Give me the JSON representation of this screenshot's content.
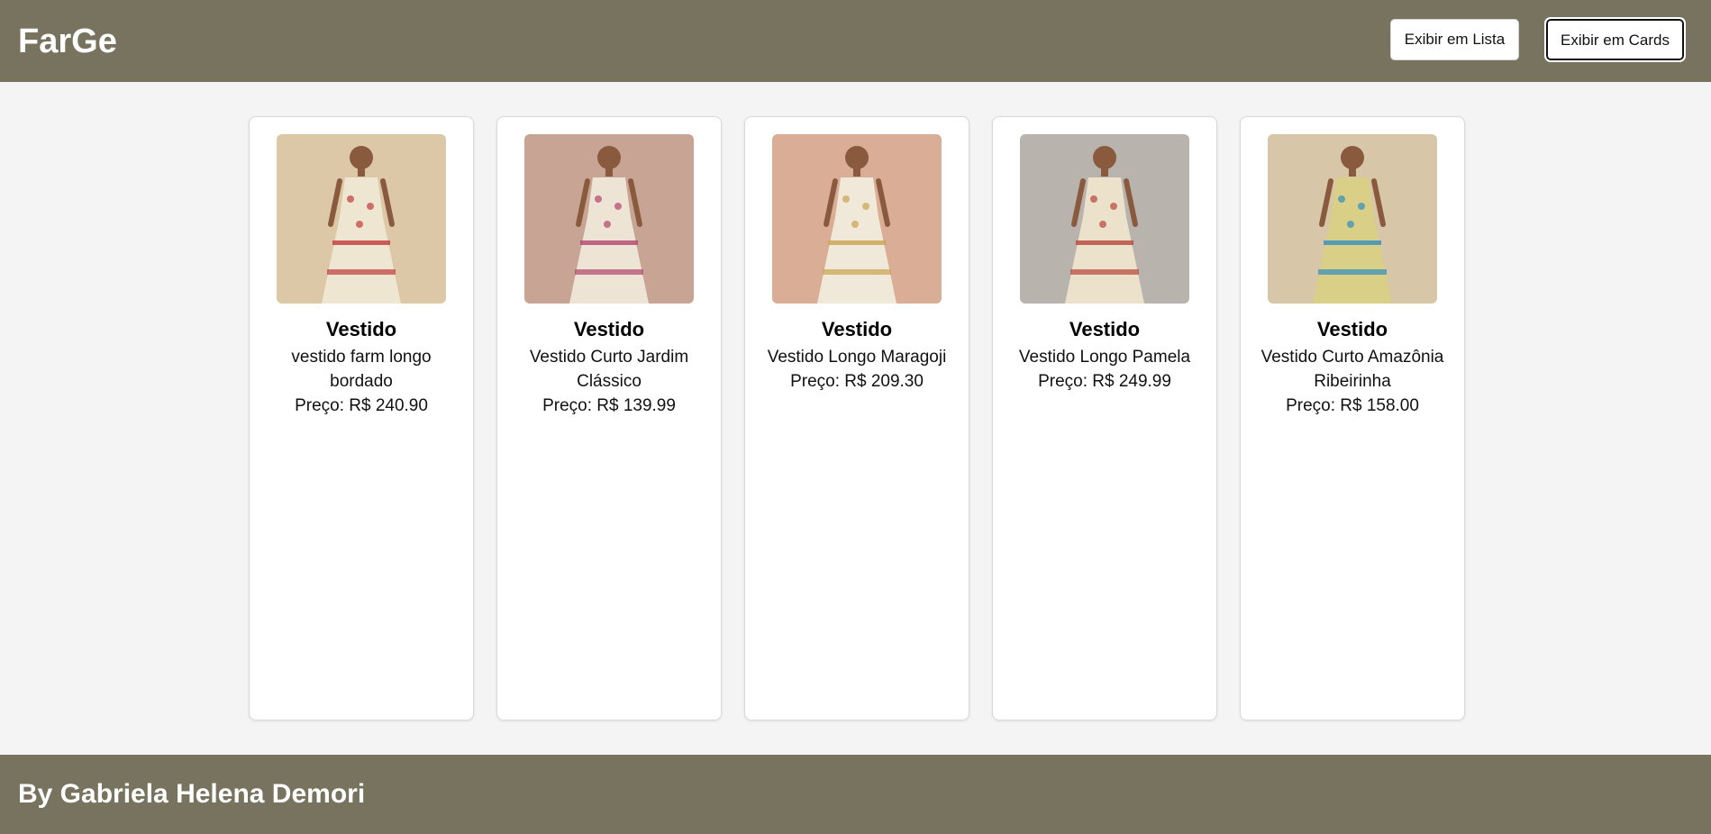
{
  "header": {
    "logo": "FarGe",
    "btn_list": "Exibir em Lista",
    "btn_cards": "Exibir em Cards"
  },
  "products": [
    {
      "title": "Vestido",
      "name": "vestido farm longo bordado",
      "price": "Preço: R$ 240.90",
      "bg": "#dcc8a6",
      "dress": "#efe6d2",
      "accent": "#c23a3a"
    },
    {
      "title": "Vestido",
      "name": "Vestido Curto Jardim Clássico",
      "price": "Preço: R$ 139.99",
      "bg": "#c7a494",
      "dress": "#eee4d6",
      "accent": "#b0446a"
    },
    {
      "title": "Vestido",
      "name": "Vestido Longo Maragoji",
      "price": "Preço: R$ 209.30",
      "bg": "#d9ad96",
      "dress": "#f0e8d8",
      "accent": "#c9a24e"
    },
    {
      "title": "Vestido",
      "name": "Vestido Longo Pamela",
      "price": "Preço: R$ 249.99",
      "bg": "#b9b3ad",
      "dress": "#ece2cc",
      "accent": "#b8463c"
    },
    {
      "title": "Vestido",
      "name": "Vestido Curto Amazônia Ribeirinha",
      "price": "Preço: R$ 158.00",
      "bg": "#d8c6a8",
      "dress": "#d9cf86",
      "accent": "#2f8fbf"
    }
  ],
  "footer": {
    "text": "By Gabriela Helena Demori"
  }
}
